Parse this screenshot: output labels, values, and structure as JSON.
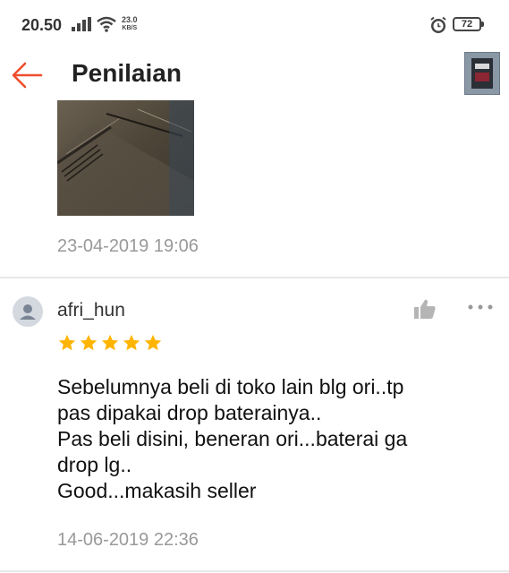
{
  "status_bar": {
    "time": "20.50",
    "network_speed_value": "23.0",
    "network_speed_unit": "KB/S",
    "battery": "72"
  },
  "header": {
    "title": "Penilaian"
  },
  "reviews": [
    {
      "date": "23-04-2019 19:06"
    },
    {
      "username": "afri_hun",
      "rating": 5,
      "rating_max": 5,
      "text_lines": [
        "Sebelumnya beli di toko lain blg ori..tp",
        "pas dipakai drop baterainya..",
        "Pas beli disini, beneran ori...baterai ga",
        "drop lg..",
        "Good...makasih seller"
      ],
      "date": "14-06-2019 22:36"
    }
  ],
  "icons": {
    "back": "arrow-left-icon",
    "like": "thumbs-up-icon",
    "more": "more-horizontal-icon",
    "avatar": "user-avatar-icon",
    "star": "star-icon"
  },
  "colors": {
    "back_arrow": "#ee4d2d",
    "star": "#ffb400",
    "date_text": "#999999"
  }
}
